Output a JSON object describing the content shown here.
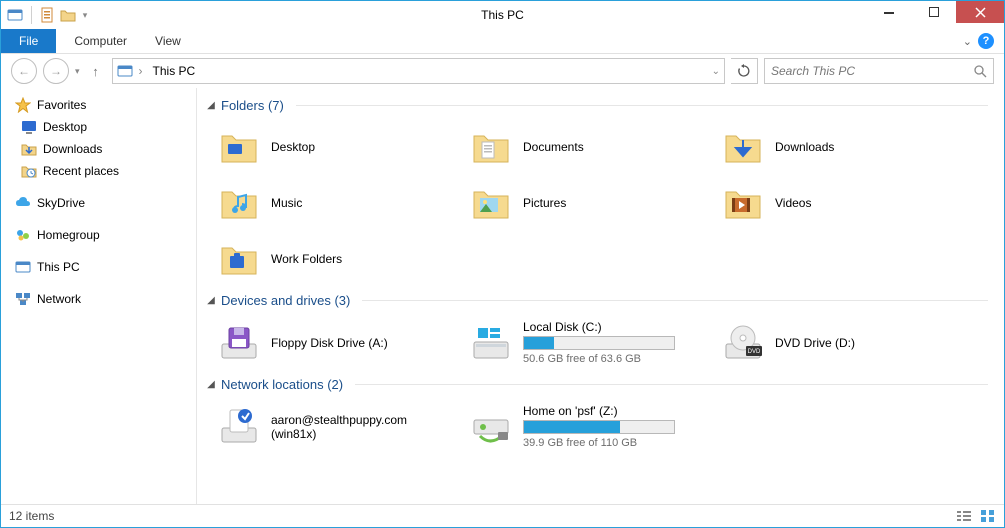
{
  "window": {
    "title": "This PC"
  },
  "ribbon": {
    "file": "File",
    "tabs": [
      "Computer",
      "View"
    ]
  },
  "nav": {
    "breadcrumb": [
      "This PC"
    ],
    "searchPlaceholder": "Search This PC"
  },
  "sidebar": {
    "favorites": {
      "label": "Favorites",
      "items": [
        "Desktop",
        "Downloads",
        "Recent places"
      ]
    },
    "skydrive": {
      "label": "SkyDrive"
    },
    "homegroup": {
      "label": "Homegroup"
    },
    "thispc": {
      "label": "This PC"
    },
    "network": {
      "label": "Network"
    }
  },
  "groups": {
    "folders": {
      "title": "Folders (7)",
      "items": [
        "Desktop",
        "Documents",
        "Downloads",
        "Music",
        "Pictures",
        "Videos",
        "Work Folders"
      ]
    },
    "drives": {
      "title": "Devices and drives (3)",
      "items": [
        {
          "label": "Floppy Disk Drive (A:)"
        },
        {
          "label": "Local Disk (C:)",
          "free": "50.6 GB free of 63.6 GB",
          "fillPct": 20
        },
        {
          "label": "DVD Drive (D:)"
        }
      ]
    },
    "network": {
      "title": "Network locations (2)",
      "items": [
        {
          "label": "aaron@stealthpuppy.com (win81x)"
        },
        {
          "label": "Home on 'psf' (Z:)",
          "free": "39.9 GB free of 110 GB",
          "fillPct": 64
        }
      ]
    }
  },
  "status": {
    "text": "12 items"
  }
}
